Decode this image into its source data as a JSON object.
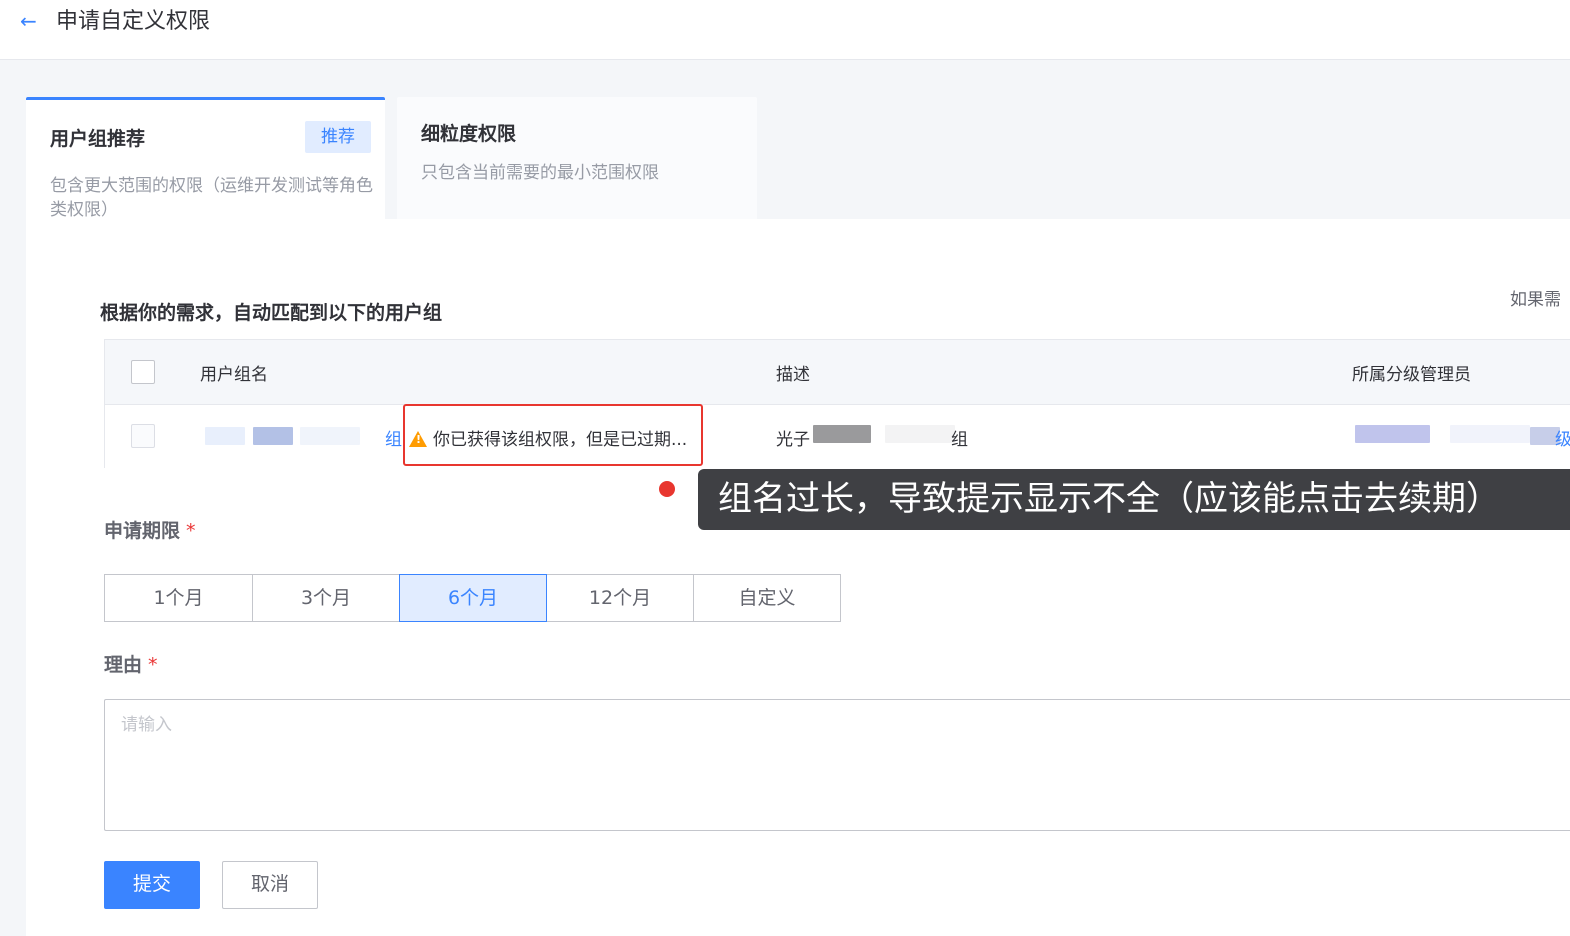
{
  "header": {
    "title": "申请自定义权限",
    "back_icon": "arrow-left-icon"
  },
  "tabs": [
    {
      "title": "用户组推荐",
      "badge": "推荐",
      "desc": "包含更大范围的权限（运维开发测试等角色类权限）"
    },
    {
      "title": "细粒度权限",
      "desc": "只包含当前需要的最小范围权限"
    }
  ],
  "match": {
    "title": "根据你的需求，自动匹配到以下的用户组",
    "right_hint": "如果需"
  },
  "table": {
    "headers": [
      "用户组名",
      "描述",
      "所属分级管理员"
    ],
    "row": {
      "name_suffix": "组",
      "warning": "你已获得该组权限，但是已过期...",
      "desc_prefix": "光子",
      "desc_suffix": "组",
      "admin_suffix": "级"
    }
  },
  "annotation": {
    "text": "组名过长，导致提示显示不全（应该能点击去续期）"
  },
  "duration": {
    "label": "申请期限",
    "required": "*",
    "options": [
      "1个月",
      "3个月",
      "6个月",
      "12个月",
      "自定义"
    ],
    "selected": "6个月"
  },
  "reason": {
    "label": "理由",
    "required": "*",
    "placeholder": "请输入"
  },
  "actions": {
    "submit": "提交",
    "cancel": "取消"
  },
  "colors": {
    "primary": "#3a84ff",
    "warning": "#ff9c01",
    "danger": "#ea3636",
    "annotation_red": "#e8362f"
  }
}
